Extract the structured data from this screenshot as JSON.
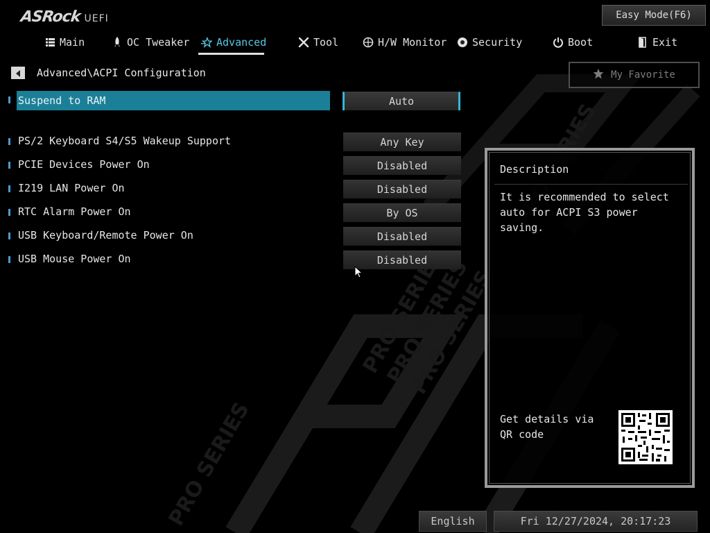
{
  "header": {
    "brand": "ASRock",
    "product": "UEFI",
    "easy_mode_label": "Easy Mode(F6)"
  },
  "tabs": [
    {
      "label": "Main",
      "icon": "list-icon"
    },
    {
      "label": "OC Tweaker",
      "icon": "rocket-icon"
    },
    {
      "label": "Advanced",
      "icon": "star-icon",
      "active": true
    },
    {
      "label": "Tool",
      "icon": "wrench-icon"
    },
    {
      "label": "H/W Monitor",
      "icon": "monitor-icon"
    },
    {
      "label": "Security",
      "icon": "shield-icon"
    },
    {
      "label": "Boot",
      "icon": "power-icon"
    },
    {
      "label": "Exit",
      "icon": "exit-door-icon"
    }
  ],
  "breadcrumb": "Advanced\\ACPI Configuration",
  "favorite_label": "My Favorite",
  "settings": [
    {
      "label": "Suspend to RAM",
      "value": "Auto",
      "selected": true
    },
    {
      "label": "PS/2 Keyboard S4/S5 Wakeup Support",
      "value": "Any Key"
    },
    {
      "label": "PCIE Devices Power On",
      "value": "Disabled"
    },
    {
      "label": "I219 LAN Power On",
      "value": "Disabled"
    },
    {
      "label": "RTC Alarm Power On",
      "value": "By OS"
    },
    {
      "label": "USB Keyboard/Remote Power On",
      "value": "Disabled"
    },
    {
      "label": "USB Mouse Power On",
      "value": "Disabled"
    }
  ],
  "description": {
    "title": "Description",
    "text": "It is recommended to select auto for ACPI S3 power saving.",
    "qr_text": "Get details via QR code"
  },
  "footer": {
    "language": "English",
    "datetime": "Fri 12/27/2024, 20:17:23"
  },
  "colors": {
    "accent": "#55c8e6",
    "selection": "#1b7f97",
    "background": "#000000"
  }
}
